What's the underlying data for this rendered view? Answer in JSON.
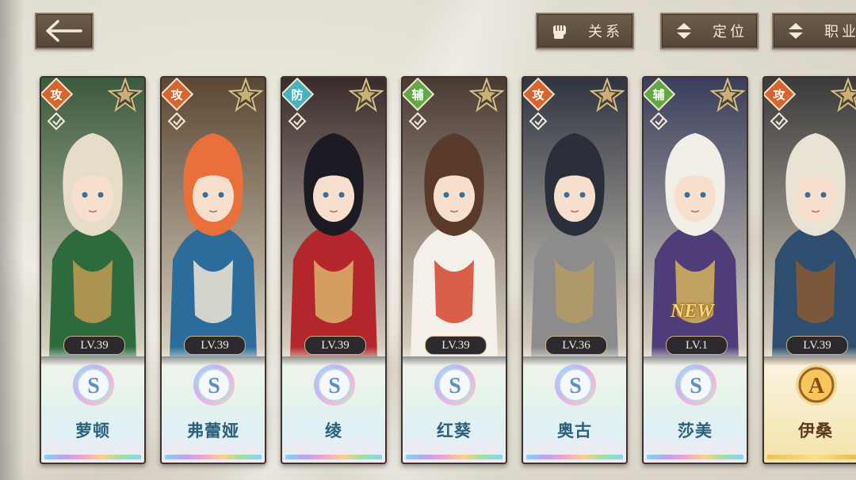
{
  "header": {
    "back_icon": "back-arrow-icon",
    "filters": [
      {
        "label": "关系",
        "icon": "fist-icon"
      },
      {
        "label": "定位",
        "icon": "sort-arrows-icon"
      },
      {
        "label": "职业",
        "icon": "sort-arrows-icon"
      }
    ]
  },
  "characters": [
    {
      "name": "萝顿",
      "role": "攻",
      "level": "LV.39",
      "rank": "S",
      "new": false
    },
    {
      "name": "弗蕾娅",
      "role": "攻",
      "level": "LV.39",
      "rank": "S",
      "new": false
    },
    {
      "name": "绫",
      "role": "防",
      "level": "LV.39",
      "rank": "S",
      "new": false
    },
    {
      "name": "红葵",
      "role": "辅",
      "level": "LV.39",
      "rank": "S",
      "new": false
    },
    {
      "name": "奥古",
      "role": "攻",
      "level": "LV.36",
      "rank": "S",
      "new": false
    },
    {
      "name": "莎美",
      "role": "辅",
      "level": "LV.1",
      "rank": "S",
      "new": true,
      "new_label": "NEW"
    },
    {
      "name": "伊桑",
      "role": "攻",
      "level": "LV.39",
      "rank": "A",
      "new": false
    }
  ],
  "colors": {
    "role_attack": "#d8642e",
    "role_defense": "#46b1bf",
    "role_support": "#62a845",
    "name_text": "#2b5f7a",
    "button_bg": "#5f5041"
  }
}
